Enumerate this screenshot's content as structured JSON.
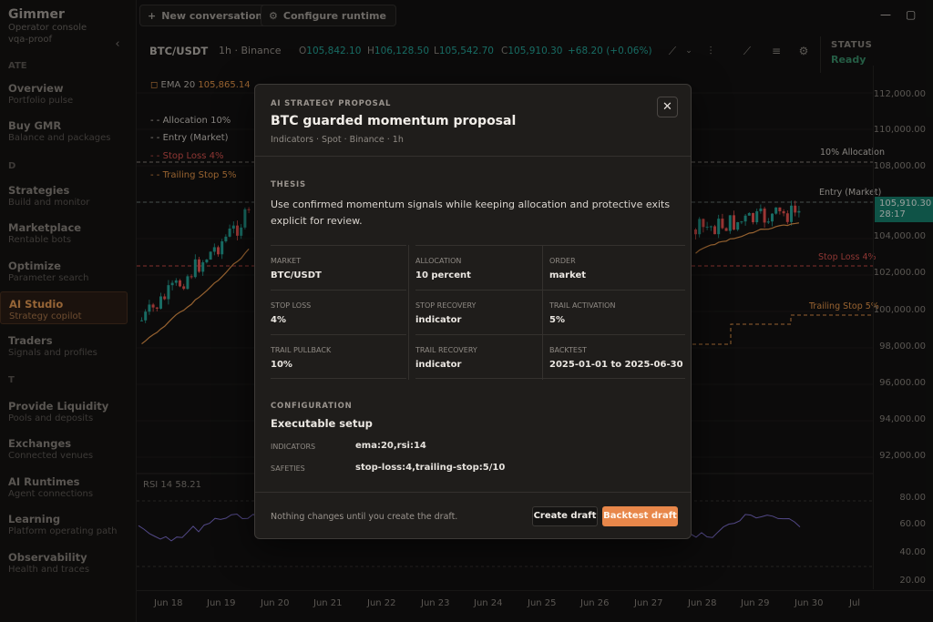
{
  "app": {
    "name": "Gimmer",
    "subtitle": "Operator console",
    "workspace": "vqa-proof"
  },
  "sidebar": {
    "sections": [
      "ATE",
      "D",
      "T"
    ],
    "items": [
      {
        "title": "Overview",
        "sub": "Portfolio pulse"
      },
      {
        "title": "Buy GMR",
        "sub": "Balance and packages"
      },
      {
        "title": "Strategies",
        "sub": "Build and monitor"
      },
      {
        "title": "Marketplace",
        "sub": "Rentable bots"
      },
      {
        "title": "Optimize",
        "sub": "Parameter search"
      },
      {
        "title": "AI Studio",
        "sub": "Strategy copilot"
      },
      {
        "title": "Traders",
        "sub": "Signals and profiles"
      },
      {
        "title": "Provide Liquidity",
        "sub": "Pools and deposits"
      },
      {
        "title": "Exchanges",
        "sub": "Connected venues"
      },
      {
        "title": "AI Runtimes",
        "sub": "Agent connections"
      },
      {
        "title": "Learning",
        "sub": "Platform operating path"
      },
      {
        "title": "Observability",
        "sub": "Health and traces"
      }
    ]
  },
  "toolbar": {
    "new_conversation": "New conversation",
    "configure_runtime": "Configure runtime"
  },
  "chart": {
    "pair": "BTC/USDT",
    "timeframe": "1h · Binance",
    "open_label": "O",
    "open": "105,842.10",
    "high_label": "H",
    "high": "106,128.50",
    "low_label": "L",
    "low": "105,542.70",
    "close_label": "C",
    "close": "105,910.30",
    "change": "+68.20 (+0.06%)",
    "ema_label": "EMA 20",
    "ema_value": "105,865.14",
    "legend": [
      {
        "label": "Allocation",
        "value": "10%",
        "color": "#cfcac4"
      },
      {
        "label": "Entry (Market)",
        "value": "",
        "color": "#cfcac4"
      },
      {
        "label": "Stop Loss",
        "value": "4%",
        "color": "#d9534f"
      },
      {
        "label": "Trailing Stop",
        "value": "5%",
        "color": "#e8974a"
      }
    ],
    "line_labels": {
      "allocation": "10% Allocation",
      "entry": "Entry (Market)",
      "stop": "Stop Loss 4%",
      "trailing": "Trailing Stop 5%"
    },
    "price_axis": [
      "112,000.00",
      "110,000.00",
      "108,000.00",
      "104,000.00",
      "102,000.00",
      "100,000.00",
      "98,000.00",
      "96,000.00",
      "94,000.00",
      "92,000.00"
    ],
    "price_tag": {
      "price": "105,910.30",
      "countdown": "28:17"
    },
    "rsi_label": "RSI 14",
    "rsi_value": "58.21",
    "rsi_axis": [
      "80.00",
      "60.00",
      "40.00",
      "20.00"
    ],
    "time_axis": [
      "Jun 18",
      "Jun 19",
      "Jun 20",
      "Jun 21",
      "Jun 22",
      "Jun 23",
      "Jun 24",
      "Jun 25",
      "Jun 26",
      "Jun 27",
      "Jun 28",
      "Jun 29",
      "Jun 30",
      "Jul"
    ],
    "colors": {
      "up": "#26a69a",
      "down": "#ef5350",
      "ema": "#e8974a",
      "rsi": "#7e6fd0"
    }
  },
  "status": {
    "label": "STATUS",
    "value": "Ready"
  },
  "modal": {
    "kicker": "AI STRATEGY PROPOSAL",
    "title": "BTC guarded momentum proposal",
    "subtitle": "Indicators · Spot · Binance · 1h",
    "thesis_label": "THESIS",
    "thesis": "Use confirmed momentum signals while keeping allocation and protective exits explicit for review.",
    "fields": [
      {
        "k": "MARKET",
        "v": "BTC/USDT"
      },
      {
        "k": "ALLOCATION",
        "v": "10 percent"
      },
      {
        "k": "ORDER",
        "v": "market"
      },
      {
        "k": "STOP LOSS",
        "v": "4%"
      },
      {
        "k": "STOP RECOVERY",
        "v": "indicator"
      },
      {
        "k": "TRAIL ACTIVATION",
        "v": "5%"
      },
      {
        "k": "TRAIL PULLBACK",
        "v": "10%"
      },
      {
        "k": "TRAIL RECOVERY",
        "v": "indicator"
      },
      {
        "k": "BACKTEST",
        "v": "2025-01-01 to 2025-06-30"
      }
    ],
    "config_label": "CONFIGURATION",
    "config_title": "Executable setup",
    "indicators_label": "INDICATORS",
    "indicators": "ema:20,rsi:14",
    "safeties_label": "SAFETIES",
    "safeties": "stop-loss:4,trailing-stop:5/10",
    "footer_note": "Nothing changes until you create the draft.",
    "create_label": "Create draft",
    "backtest_label": "Backtest draft"
  }
}
